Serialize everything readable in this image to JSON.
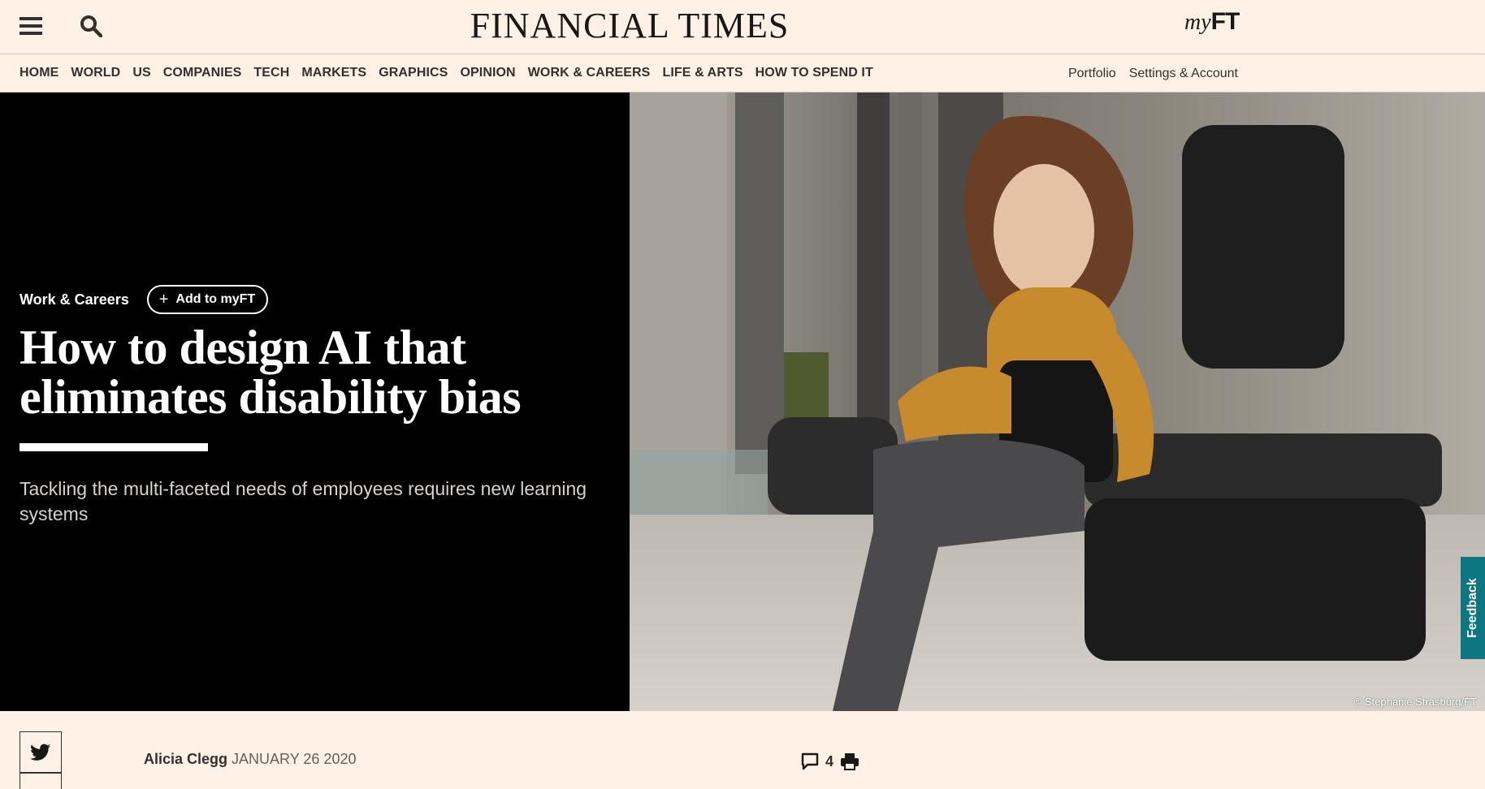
{
  "header": {
    "masthead": "FINANCIAL TIMES",
    "myft_my": "my",
    "myft_ft": "FT"
  },
  "nav": {
    "items": [
      "HOME",
      "WORLD",
      "US",
      "COMPANIES",
      "TECH",
      "MARKETS",
      "GRAPHICS",
      "OPINION",
      "WORK & CAREERS",
      "LIFE & ARTS",
      "HOW TO SPEND IT"
    ],
    "right": [
      "Portfolio",
      "Settings & Account"
    ]
  },
  "article": {
    "section": "Work & Careers",
    "add_myft_label": "Add to myFT",
    "headline": "How to design AI that eliminates disability bias",
    "standfirst": "Tackling the multi-faceted needs of employees requires new learning systems",
    "image_credit": "© Stephanie Strasburg/FT",
    "author": "Alicia Clegg",
    "date": "JANUARY 26 2020",
    "comment_count": "4"
  },
  "feedback_label": "Feedback",
  "colors": {
    "background": "#fff1e5",
    "hero_left": "#000000",
    "feedback": "#0d7680"
  }
}
